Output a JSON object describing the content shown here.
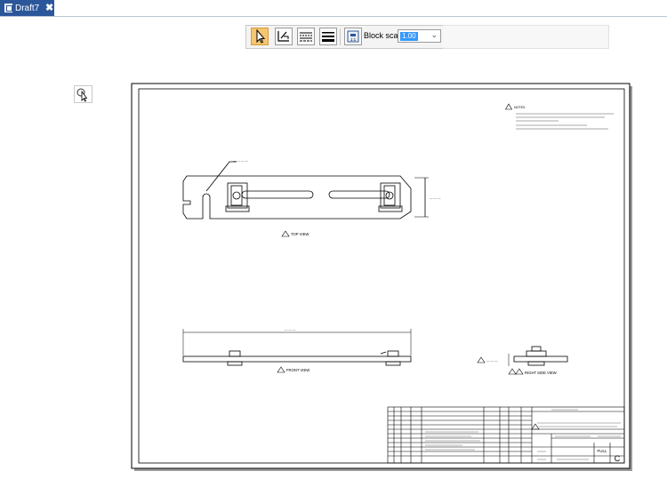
{
  "tab": {
    "title": "Draft7",
    "close_glyph": "✖"
  },
  "toolbar": {
    "tools": [
      {
        "name": "select-tool",
        "icon": "arrow-cursor-icon",
        "active": true
      },
      {
        "name": "sketch-tool",
        "icon": "line-sketch-icon",
        "active": false
      },
      {
        "name": "layers-tool",
        "icon": "lines-icon",
        "active": false
      },
      {
        "name": "lineweight-tool",
        "icon": "thick-lines-icon",
        "active": false
      },
      {
        "name": "block-tool",
        "icon": "block-icon",
        "active": false
      }
    ],
    "block_scale_label": "Block scale:",
    "block_scale_value": "1.00"
  },
  "drawing": {
    "views": {
      "top": "TOP VIEW",
      "front": "FRONT VIEW",
      "right": "RIGHT SIDE VIEW"
    },
    "notes_title": "NOTES",
    "title_block": {
      "scale": "FULL",
      "revision": "C"
    },
    "colors": {
      "line": "#000000",
      "accent": "#2b579a",
      "highlight": "#f6c56f"
    }
  }
}
